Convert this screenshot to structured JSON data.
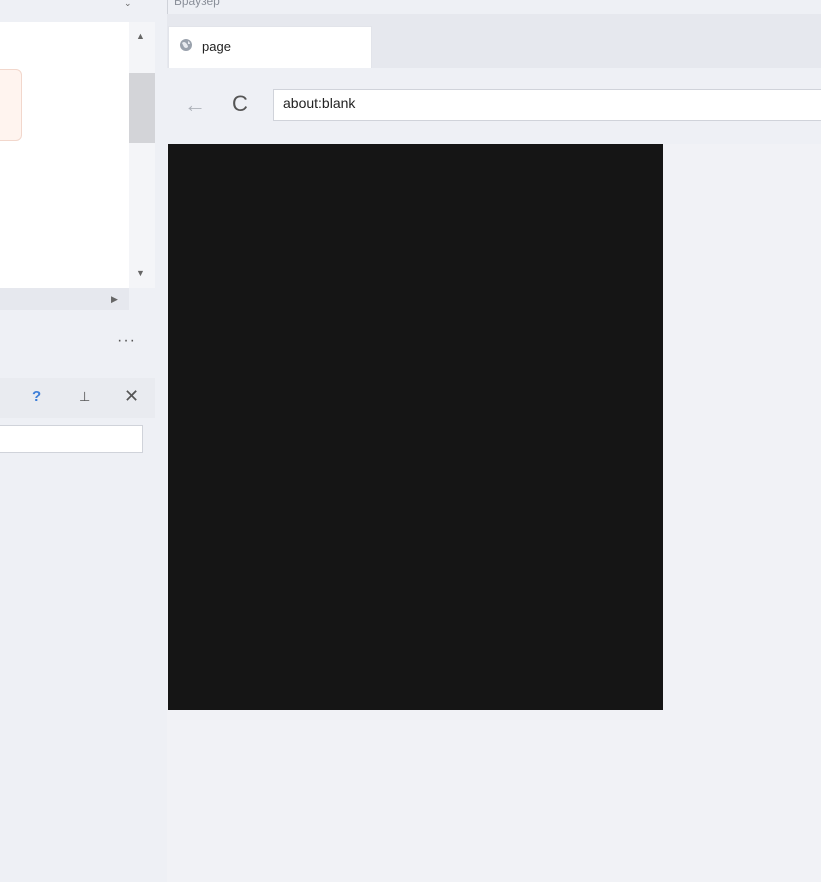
{
  "left_panel_top": {
    "list_scroll_up": "▲",
    "list_scroll_down": "▼",
    "hscroll_right": "▶",
    "collapsed_arrow": "⌄",
    "more_label": "···"
  },
  "left_panel_bottom": {
    "help_label": "?",
    "pin_label": "⊥",
    "close_label": "✕",
    "search_value": ""
  },
  "browser": {
    "panel_title": "Браузер",
    "tab_label": "page",
    "address_value": "about:blank",
    "back_label": "←",
    "reload_label": "C"
  },
  "colors": {
    "canvas": "#151515",
    "accent": "#3d7ed8"
  }
}
